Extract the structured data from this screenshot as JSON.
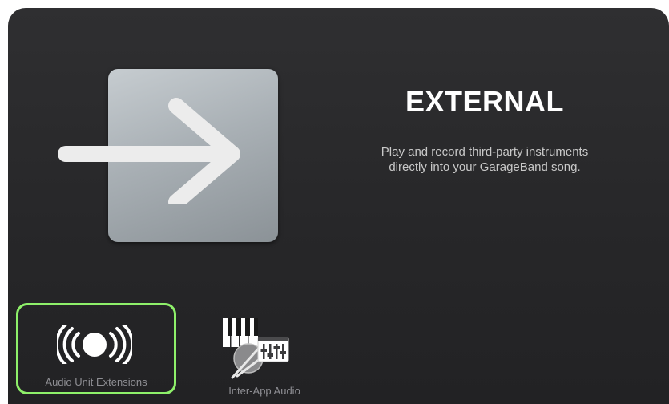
{
  "hero": {
    "icon": "arrow-right-icon",
    "title": "EXTERNAL",
    "description_line1": "Play and record third-party instruments",
    "description_line2": "directly into your GarageBand song."
  },
  "options": [
    {
      "label": "Audio Unit Extensions",
      "icon": "broadcast-icon",
      "selected": true
    },
    {
      "label": "Inter-App Audio",
      "icon": "keyboard-mixer-icon",
      "selected": false
    }
  ],
  "colors": {
    "panel_background": "#2a2a2c",
    "selection_outline": "#8ef06a",
    "title": "#ffffff",
    "description": "#c8c8c8",
    "label": "#8e8e93"
  }
}
